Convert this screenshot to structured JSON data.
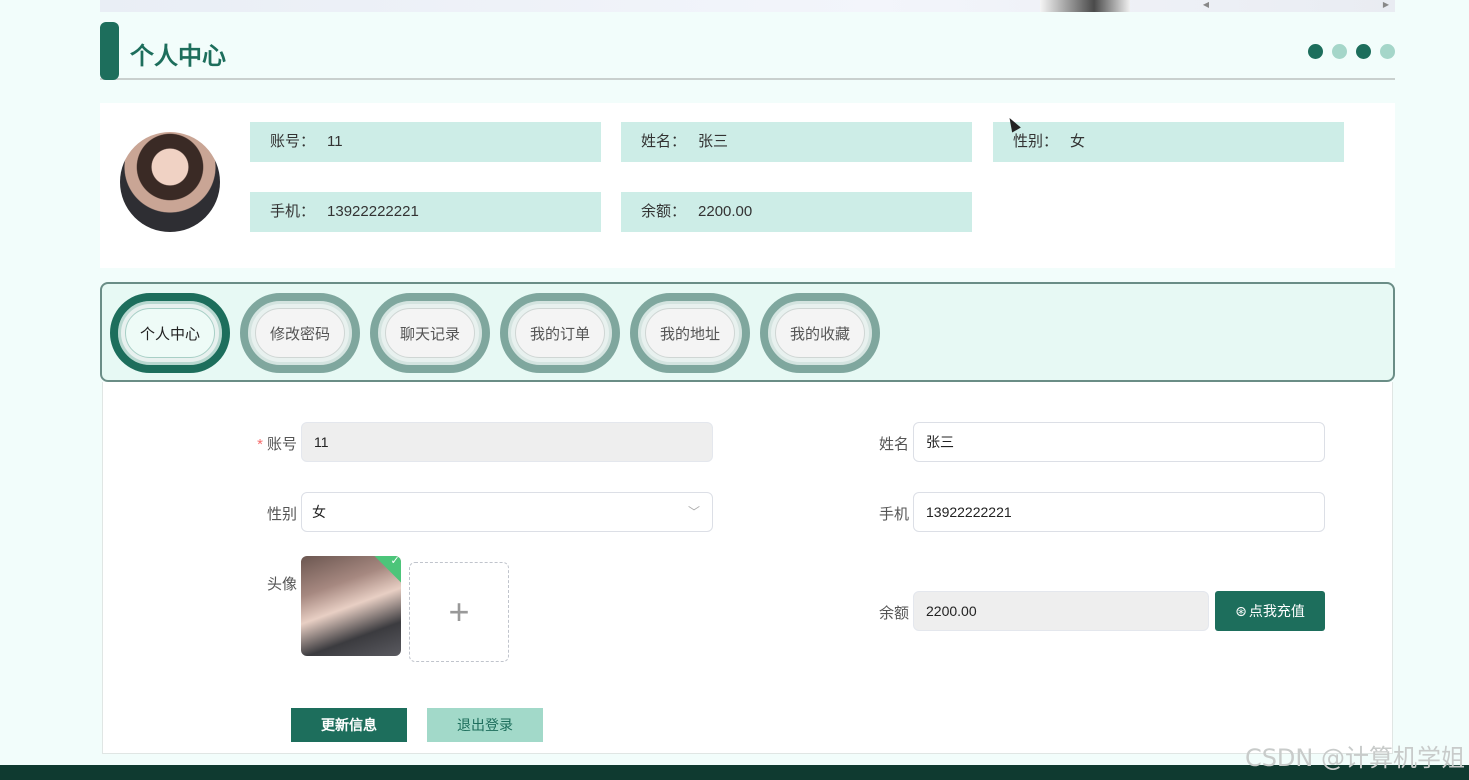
{
  "header": {
    "title": "个人中心",
    "dot_colors": [
      "#1d6e5c",
      "#a5d6c9",
      "#1d6e5c",
      "#a5d6c9"
    ]
  },
  "info": {
    "account_label": "账号：",
    "account_value": "11",
    "name_label": "姓名：",
    "name_value": "张三",
    "gender_label": "性别：",
    "gender_value": "女",
    "phone_label": "手机：",
    "phone_value": "13922222221",
    "balance_label": "余额：",
    "balance_value": "2200.00"
  },
  "tabs": [
    {
      "label": "个人中心",
      "active": true
    },
    {
      "label": "修改密码",
      "active": false
    },
    {
      "label": "聊天记录",
      "active": false
    },
    {
      "label": "我的订单",
      "active": false
    },
    {
      "label": "我的地址",
      "active": false
    },
    {
      "label": "我的收藏",
      "active": false
    }
  ],
  "form": {
    "account_label": "账号",
    "account_value": "11",
    "name_label": "姓名",
    "name_value": "张三",
    "gender_label": "性别",
    "gender_value": "女",
    "phone_label": "手机",
    "phone_value": "13922222221",
    "avatar_label": "头像",
    "balance_label": "余额",
    "balance_value": "2200.00",
    "recharge_label": "点我充值",
    "update_label": "更新信息",
    "logout_label": "退出登录"
  },
  "watermark": "CSDN @计算机学姐",
  "colors": {
    "accent": "#1d6e5c",
    "light_accent": "#cdede7"
  }
}
